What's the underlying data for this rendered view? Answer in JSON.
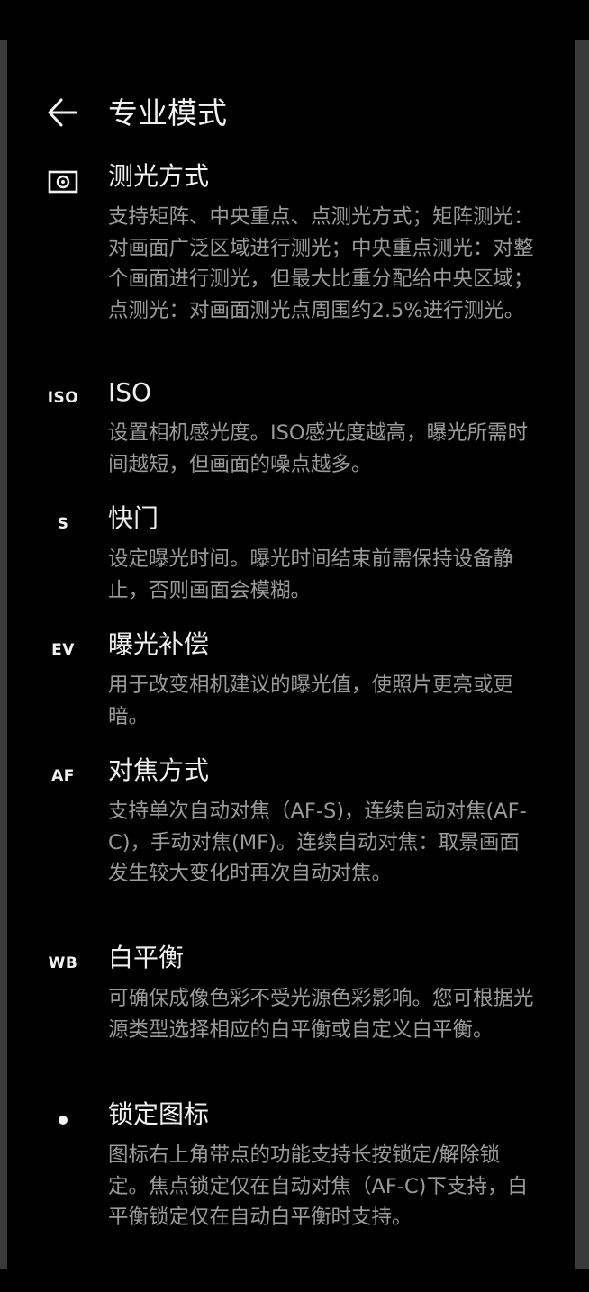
{
  "header": {
    "title": "专业模式",
    "back_icon": "back-arrow-icon"
  },
  "colors": {
    "background": "#000000",
    "title_text": "#f0f0f0",
    "description_text": "#9a9a9a"
  },
  "items": [
    {
      "icon": "metering-icon",
      "icon_text": "",
      "title": "测光方式",
      "description": "支持矩阵、中央重点、点测光方式；矩阵测光：对画面广泛区域进行测光；中央重点测光：对整个画面进行测光，但最大比重分配给中央区域；点测光：对画面测光点周围约2.5%进行测光。"
    },
    {
      "icon": "iso-icon",
      "icon_text": "ISO",
      "title": "ISO",
      "description": "设置相机感光度。ISO感光度越高，曝光所需时间越短，但画面的噪点越多。"
    },
    {
      "icon": "shutter-icon",
      "icon_text": "S",
      "title": "快门",
      "description": "设定曝光时间。曝光时间结束前需保持设备静止，否则画面会模糊。"
    },
    {
      "icon": "exposure-compensation-icon",
      "icon_text": "EV",
      "title": "曝光补偿",
      "description": "用于改变相机建议的曝光值，使照片更亮或更暗。"
    },
    {
      "icon": "focus-mode-icon",
      "icon_text": "AF",
      "title": "对焦方式",
      "description": "支持单次自动对焦（AF-S)，连续自动对焦(AF-C)，手动对焦(MF)。连续自动对焦：取景画面发生较大变化时再次自动对焦。"
    },
    {
      "icon": "white-balance-icon",
      "icon_text": "WB",
      "title": "白平衡",
      "description": "可确保成像色彩不受光源色彩影响。您可根据光源类型选择相应的白平衡或自定义白平衡。"
    },
    {
      "icon": "lock-dot-icon",
      "icon_text": "•",
      "title": "锁定图标",
      "description": "图标右上角带点的功能支持长按锁定/解除锁定。焦点锁定仅在自动对焦（AF-C)下支持，白平衡锁定仅在自动白平衡时支持。"
    }
  ]
}
